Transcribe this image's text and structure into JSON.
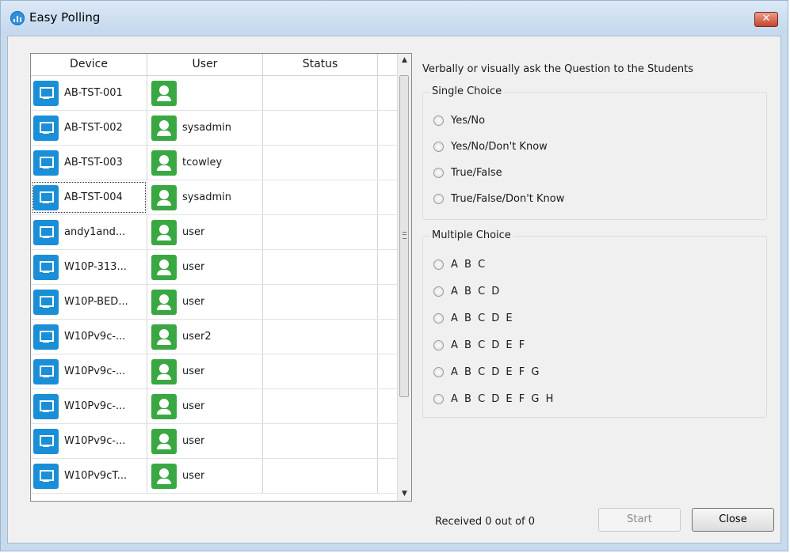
{
  "window": {
    "title": "Easy Polling",
    "close_symbol": "✕"
  },
  "table": {
    "columns": [
      "Device",
      "User",
      "Status"
    ],
    "rows": [
      {
        "device": "AB-TST-001",
        "user": "",
        "status": ""
      },
      {
        "device": "AB-TST-002",
        "user": "sysadmin",
        "status": ""
      },
      {
        "device": "AB-TST-003",
        "user": "tcowley",
        "status": ""
      },
      {
        "device": "AB-TST-004",
        "user": "sysadmin",
        "status": ""
      },
      {
        "device": "andy1and...",
        "user": "user",
        "status": ""
      },
      {
        "device": "W10P-313...",
        "user": "user",
        "status": ""
      },
      {
        "device": "W10P-BED...",
        "user": "user",
        "status": ""
      },
      {
        "device": "W10Pv9c-...",
        "user": "user2",
        "status": ""
      },
      {
        "device": "W10Pv9c-...",
        "user": "user",
        "status": ""
      },
      {
        "device": "W10Pv9c-...",
        "user": "user",
        "status": ""
      },
      {
        "device": "W10Pv9c-...",
        "user": "user",
        "status": ""
      },
      {
        "device": "W10Pv9cT...",
        "user": "user",
        "status": ""
      }
    ],
    "scroll_up": "▲",
    "scroll_down": "▼"
  },
  "prompt": "Verbally or visually ask the Question to the Students",
  "single_choice": {
    "title": "Single Choice",
    "options": [
      "Yes/No",
      "Yes/No/Don't Know",
      "True/False",
      "True/False/Don't Know"
    ]
  },
  "multiple_choice": {
    "title": "Multiple Choice",
    "options": [
      "A B C",
      "A B C D",
      "A B C D E",
      "A B C D E F",
      "A B C D E F G",
      "A B C D E F G H"
    ]
  },
  "footer": {
    "received": "Received 0 out of 0",
    "start_label": "Start",
    "close_label": "Close"
  },
  "colors": {
    "device_icon": "#1a8fd8",
    "user_icon": "#3aa842",
    "title_close": "#c8432c"
  }
}
